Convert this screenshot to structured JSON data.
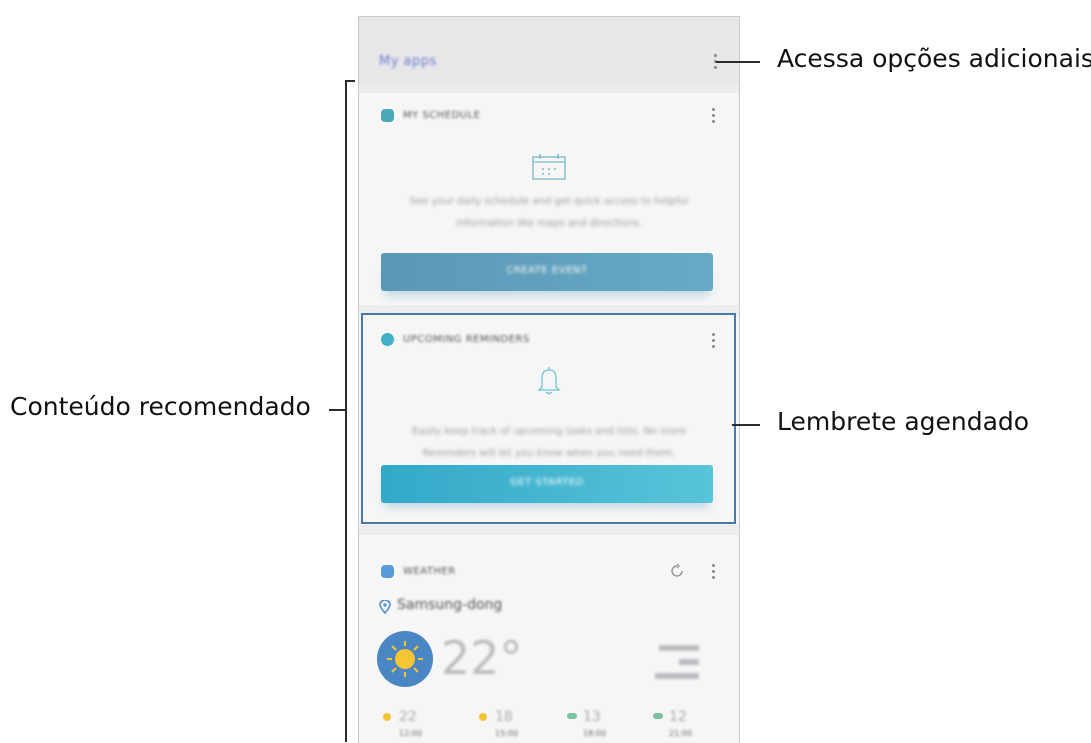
{
  "annotations": {
    "options": "Acessa opções adicionais",
    "content": "Conteúdo recomendado",
    "reminder": "Lembrete agendado"
  },
  "screen": {
    "title": "My apps",
    "cards": [
      {
        "title": "MY SCHEDULE",
        "description_line1": "See your daily schedule and get quick access to helpful",
        "description_line2": "information like maps and directions.",
        "button": "CREATE EVENT",
        "icon": "calendar-icon",
        "accent": "#4a9fb6"
      },
      {
        "title": "UPCOMING REMINDERS",
        "description_line1": "Easily keep track of upcoming tasks and lists. No more",
        "description_line2": "Reminders will let you know when you need them.",
        "button": "GET STARTED",
        "icon": "bell-icon",
        "accent": "#3eb1cf"
      }
    ],
    "weather": {
      "title": "WEATHER",
      "location": "Samsung-dong",
      "temperature": "22°",
      "forecast": [
        {
          "temp": "22",
          "time": "12:00"
        },
        {
          "temp": "18",
          "time": "15:00"
        },
        {
          "temp": "13",
          "time": "18:00"
        },
        {
          "temp": "12",
          "time": "21:00"
        }
      ]
    }
  }
}
